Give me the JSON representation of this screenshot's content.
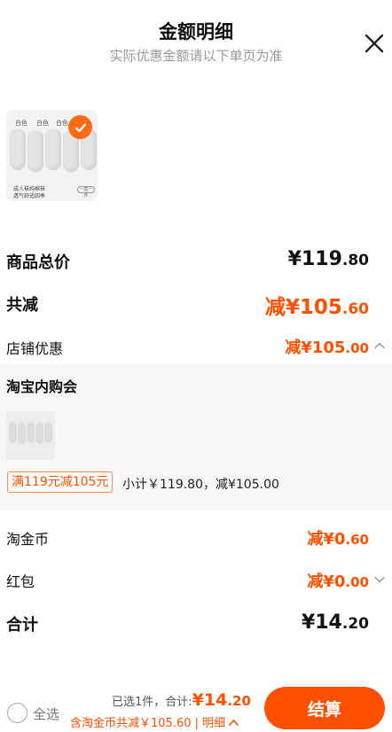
{
  "header": {
    "title": "金额明细",
    "subtitle": "实际优惠金额请以下单页为准"
  },
  "product": {
    "image_icon": "sock-product-image",
    "image_label_1": "白色",
    "image_label_2": "白色",
    "image_label_3": "白色",
    "image_caption": "成人袜纯棉袜",
    "image_caption2": "透气舒适四季",
    "image_pill": "一盒一件"
  },
  "summary": {
    "total_label": "商品总价",
    "total_int": "¥119",
    "total_dec": ".80",
    "discount_label": "共减",
    "discount_int": "减¥105",
    "discount_dec": ".60",
    "store_label": "店铺优惠",
    "store_int": "减¥105",
    "store_dec": ".00"
  },
  "store_panel": {
    "name": "淘宝内购会",
    "promo": "满119元减105元",
    "subtotal": "小计￥119.80，减¥105.00"
  },
  "coins": {
    "label": "淘金币",
    "value_int": "减¥0",
    "value_dec": ".60"
  },
  "red_packet": {
    "label": "红包",
    "value_int": "减¥0",
    "value_dec": ".00"
  },
  "total": {
    "label": "合计",
    "value_int": "¥14",
    "value_dec": ".20"
  },
  "footer": {
    "select_all": "全选",
    "selected_text": "已选1件，合计:",
    "selected_amount_int": "¥14",
    "selected_amount_dec": ".20",
    "sub_text": "含淘金币共减￥105.60 | 明细",
    "checkout": "结算"
  },
  "colors": {
    "accent": "#ff5000",
    "check_badge": "#ff6a12"
  }
}
